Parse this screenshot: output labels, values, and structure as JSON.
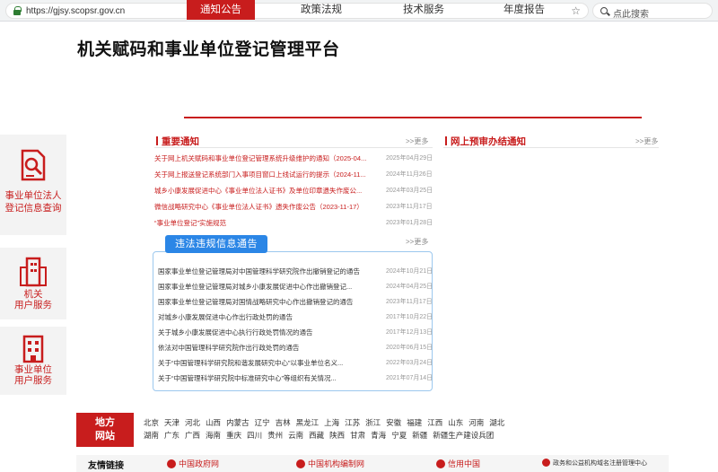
{
  "browser": {
    "url": "https://gjsy.scopsr.gov.cn",
    "search_placeholder": "点此搜索"
  },
  "site": {
    "title": "机关赋码和事业单位登记管理平台"
  },
  "nav": {
    "items": [
      {
        "label": "通知公告",
        "active": true
      },
      {
        "label": "政策法规",
        "active": false
      },
      {
        "label": "技术服务",
        "active": false
      },
      {
        "label": "年度报告",
        "active": false
      }
    ]
  },
  "tiles": [
    {
      "label_line1": "事业单位法人",
      "label_line2": "登记信息查询",
      "icon": "search-document-icon"
    },
    {
      "label_line1": "机关",
      "label_line2": "用户服务",
      "icon": "building-icon"
    },
    {
      "label_line1": "事业单位",
      "label_line2": "用户服务",
      "icon": "office-building-icon"
    }
  ],
  "important": {
    "title": "重要通知",
    "more": ">>更多",
    "items": [
      {
        "title": "关于网上机关赋码和事业单位登记管理系统升级维护的通知（2025-04...",
        "date": "2025年04月29日"
      },
      {
        "title": "关于网上报送登记系统部门入事项目窗口上线试运行的提示（2024-11...",
        "date": "2024年11月26日"
      },
      {
        "title": "城乡小康发展促进中心《事业单位法人证书》及单位印章遗失作废公...",
        "date": "2024年03月25日"
      },
      {
        "title": "微信战略研究中心《事业单位法人证书》遗失作废公告（2023-11-17）",
        "date": "2023年11月17日"
      },
      {
        "title": "“事业单位登记”实施规范",
        "date": "2023年01月28日"
      }
    ]
  },
  "online": {
    "title": "网上预审办结通知",
    "more": ">>更多"
  },
  "illegal": {
    "badge": "违法违规信息通告",
    "more": ">>更多",
    "items": [
      {
        "title": "国家事业单位登记管理局对中国管理科学研究院作出撤销登记的通告",
        "date": "2024年10月21日"
      },
      {
        "title": "国家事业单位登记管理局对城乡小康发展促进中心作出撤销登记...",
        "date": "2024年04月25日"
      },
      {
        "title": "国家事业单位登记管理局对国情战略研究中心作出撤销登记的通告",
        "date": "2023年11月17日"
      },
      {
        "title": "对城乡小康发展促进中心作出行政处罚的通告",
        "date": "2017年10月22日"
      },
      {
        "title": "关于城乡小康发展促进中心执行行政处罚情况的通告",
        "date": "2017年12月13日"
      },
      {
        "title": "依法对中国管理科学研究院作出行政处罚的通告",
        "date": "2020年06月15日"
      },
      {
        "title": "关于“中国管理科学研究院和谐发展研究中心”以事业单位名义...",
        "date": "2022年03月24日"
      },
      {
        "title": "关于“中国管理科学研究院中标准研究中心”等组织有关情况...",
        "date": "2021年07月14日"
      }
    ]
  },
  "regions": {
    "label_line1": "地方",
    "label_line2": "网站",
    "row1": [
      "北京",
      "天津",
      "河北",
      "山西",
      "内蒙古",
      "辽宁",
      "吉林",
      "黑龙江",
      "上海",
      "江苏",
      "浙江",
      "安徽",
      "福建",
      "江西",
      "山东",
      "河南",
      "湖北"
    ],
    "row2": [
      "湖南",
      "广东",
      "广西",
      "海南",
      "重庆",
      "四川",
      "贵州",
      "云南",
      "西藏",
      "陕西",
      "甘肃",
      "青海",
      "宁夏",
      "新疆",
      "新疆生产建设兵团"
    ]
  },
  "friend_links": {
    "label": "友情链接",
    "items": [
      "中国政府网",
      "中国机构编制网",
      "信用中国",
      "政务和公益机构域名注册管理中心"
    ]
  },
  "colors": {
    "brand_red": "#c81d1d",
    "accent_blue": "#2b86e6"
  }
}
